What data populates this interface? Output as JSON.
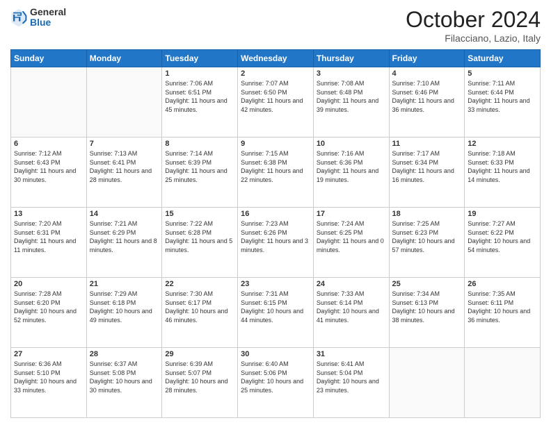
{
  "header": {
    "logo_general": "General",
    "logo_blue": "Blue",
    "month_title": "October 2024",
    "location": "Filacciano, Lazio, Italy"
  },
  "weekdays": [
    "Sunday",
    "Monday",
    "Tuesday",
    "Wednesday",
    "Thursday",
    "Friday",
    "Saturday"
  ],
  "weeks": [
    [
      {
        "day": "",
        "info": ""
      },
      {
        "day": "",
        "info": ""
      },
      {
        "day": "1",
        "info": "Sunrise: 7:06 AM\nSunset: 6:51 PM\nDaylight: 11 hours and 45 minutes."
      },
      {
        "day": "2",
        "info": "Sunrise: 7:07 AM\nSunset: 6:50 PM\nDaylight: 11 hours and 42 minutes."
      },
      {
        "day": "3",
        "info": "Sunrise: 7:08 AM\nSunset: 6:48 PM\nDaylight: 11 hours and 39 minutes."
      },
      {
        "day": "4",
        "info": "Sunrise: 7:10 AM\nSunset: 6:46 PM\nDaylight: 11 hours and 36 minutes."
      },
      {
        "day": "5",
        "info": "Sunrise: 7:11 AM\nSunset: 6:44 PM\nDaylight: 11 hours and 33 minutes."
      }
    ],
    [
      {
        "day": "6",
        "info": "Sunrise: 7:12 AM\nSunset: 6:43 PM\nDaylight: 11 hours and 30 minutes."
      },
      {
        "day": "7",
        "info": "Sunrise: 7:13 AM\nSunset: 6:41 PM\nDaylight: 11 hours and 28 minutes."
      },
      {
        "day": "8",
        "info": "Sunrise: 7:14 AM\nSunset: 6:39 PM\nDaylight: 11 hours and 25 minutes."
      },
      {
        "day": "9",
        "info": "Sunrise: 7:15 AM\nSunset: 6:38 PM\nDaylight: 11 hours and 22 minutes."
      },
      {
        "day": "10",
        "info": "Sunrise: 7:16 AM\nSunset: 6:36 PM\nDaylight: 11 hours and 19 minutes."
      },
      {
        "day": "11",
        "info": "Sunrise: 7:17 AM\nSunset: 6:34 PM\nDaylight: 11 hours and 16 minutes."
      },
      {
        "day": "12",
        "info": "Sunrise: 7:18 AM\nSunset: 6:33 PM\nDaylight: 11 hours and 14 minutes."
      }
    ],
    [
      {
        "day": "13",
        "info": "Sunrise: 7:20 AM\nSunset: 6:31 PM\nDaylight: 11 hours and 11 minutes."
      },
      {
        "day": "14",
        "info": "Sunrise: 7:21 AM\nSunset: 6:29 PM\nDaylight: 11 hours and 8 minutes."
      },
      {
        "day": "15",
        "info": "Sunrise: 7:22 AM\nSunset: 6:28 PM\nDaylight: 11 hours and 5 minutes."
      },
      {
        "day": "16",
        "info": "Sunrise: 7:23 AM\nSunset: 6:26 PM\nDaylight: 11 hours and 3 minutes."
      },
      {
        "day": "17",
        "info": "Sunrise: 7:24 AM\nSunset: 6:25 PM\nDaylight: 11 hours and 0 minutes."
      },
      {
        "day": "18",
        "info": "Sunrise: 7:25 AM\nSunset: 6:23 PM\nDaylight: 10 hours and 57 minutes."
      },
      {
        "day": "19",
        "info": "Sunrise: 7:27 AM\nSunset: 6:22 PM\nDaylight: 10 hours and 54 minutes."
      }
    ],
    [
      {
        "day": "20",
        "info": "Sunrise: 7:28 AM\nSunset: 6:20 PM\nDaylight: 10 hours and 52 minutes."
      },
      {
        "day": "21",
        "info": "Sunrise: 7:29 AM\nSunset: 6:18 PM\nDaylight: 10 hours and 49 minutes."
      },
      {
        "day": "22",
        "info": "Sunrise: 7:30 AM\nSunset: 6:17 PM\nDaylight: 10 hours and 46 minutes."
      },
      {
        "day": "23",
        "info": "Sunrise: 7:31 AM\nSunset: 6:15 PM\nDaylight: 10 hours and 44 minutes."
      },
      {
        "day": "24",
        "info": "Sunrise: 7:33 AM\nSunset: 6:14 PM\nDaylight: 10 hours and 41 minutes."
      },
      {
        "day": "25",
        "info": "Sunrise: 7:34 AM\nSunset: 6:13 PM\nDaylight: 10 hours and 38 minutes."
      },
      {
        "day": "26",
        "info": "Sunrise: 7:35 AM\nSunset: 6:11 PM\nDaylight: 10 hours and 36 minutes."
      }
    ],
    [
      {
        "day": "27",
        "info": "Sunrise: 6:36 AM\nSunset: 5:10 PM\nDaylight: 10 hours and 33 minutes."
      },
      {
        "day": "28",
        "info": "Sunrise: 6:37 AM\nSunset: 5:08 PM\nDaylight: 10 hours and 30 minutes."
      },
      {
        "day": "29",
        "info": "Sunrise: 6:39 AM\nSunset: 5:07 PM\nDaylight: 10 hours and 28 minutes."
      },
      {
        "day": "30",
        "info": "Sunrise: 6:40 AM\nSunset: 5:06 PM\nDaylight: 10 hours and 25 minutes."
      },
      {
        "day": "31",
        "info": "Sunrise: 6:41 AM\nSunset: 5:04 PM\nDaylight: 10 hours and 23 minutes."
      },
      {
        "day": "",
        "info": ""
      },
      {
        "day": "",
        "info": ""
      }
    ]
  ]
}
